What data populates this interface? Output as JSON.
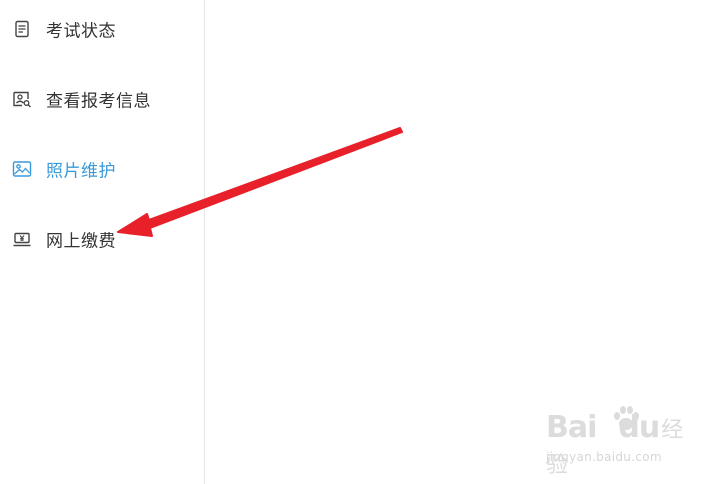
{
  "accent_color": "#3a9ad9",
  "text_color": "#333333",
  "annotation_color": "#e8202a",
  "sidebar": {
    "items": [
      {
        "label": "考试状态",
        "icon": "document-icon",
        "active": false
      },
      {
        "label": "查看报考信息",
        "icon": "id-card-search-icon",
        "active": false
      },
      {
        "label": "照片维护",
        "icon": "picture-icon",
        "active": true
      },
      {
        "label": "网上缴费",
        "icon": "yen-payment-icon",
        "active": false
      }
    ]
  },
  "watermark": {
    "logo": "Bai",
    "logo_tail": "du",
    "logo_cn": "经验",
    "url": "jingyan.baidu.com"
  }
}
